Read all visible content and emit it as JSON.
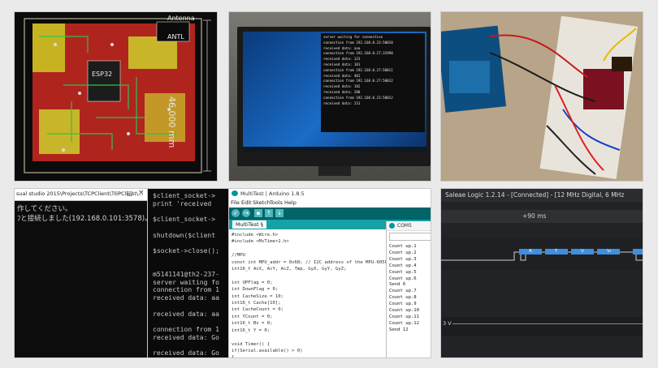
{
  "pcb": {
    "antenna": "Antenna",
    "antl": "ANTL",
    "dimension": "46.000 mm",
    "label_mid": "ESP32"
  },
  "monitor": {
    "terminal_lines": [
      "server waiting for connection",
      "connection from 192.168.0.23:50010",
      "received data: aaa",
      "connection from 192.168.0.27:31990",
      "received data: 123",
      "received data: 101",
      "connection from 192.168.0.27:50011",
      "received data: 401",
      "connection from 192.168.0.27:50012",
      "received data: 102",
      "received data: 200",
      "connection from 192.168.0.23:50012",
      "received data: 231"
    ]
  },
  "console_win": {
    "path": "sual studio 2015\\Projects\\TCPClient\\TCPClient\\...",
    "line1": "作してください。",
    "line2": "ﾌと接続しました(192.168.0.101:3578)。"
  },
  "console_php": {
    "lines": [
      "$client_socket->",
      "print 'received",
      "",
      "$client_socket->",
      "",
      "shutdown($client",
      "",
      "$socket->close();",
      "",
      "",
      "m5141141@th2-237-",
      "server waiting fo",
      "connection from 1",
      "received data: aa",
      "",
      "received data: aa",
      "",
      "connection from 1",
      "received data: Go",
      "",
      "received data: Go"
    ]
  },
  "arduino": {
    "title": "MultiTest | Arduino 1.8.5",
    "menus": [
      "File",
      "Edit",
      "Sketch",
      "Tools",
      "Help"
    ],
    "tab": "MultiTest §",
    "serial_title": "COM5",
    "code": [
      "#include <Wire.h>",
      "#include <MsTimer2.h>",
      "",
      "//MPU",
      "const int MPU_addr = 0x68; // I2C address of the MPU-6050",
      "int16_t AcX, AcY, AcZ, Tmp, GyX, GyY, GyZ;",
      "",
      "int UPFlag = 0;",
      "int DownFlag = 0;",
      "int CacheSize = 10;",
      "int16_t  Cache[10];",
      "int CacheCount = 0;",
      "int YCount = 0;",
      "int16_t Bv = 0;",
      "int16_t Y = 0;",
      "",
      "void Timer() {",
      "  if(Serial.available() > 0)",
      "  {"
    ],
    "serial_lines": [
      "Count up.1",
      "Count up.2",
      "Count up.3",
      "Count up.4",
      "Count up.5",
      "Count up.6",
      "Send 6",
      "Count up.7",
      "Count up.8",
      "Count up.9",
      "Count up.10",
      "Count up.11",
      "Count up.12",
      "Send 12"
    ]
  },
  "saleae": {
    "title": "Saleae Logic 1.2.14 - [Connected] - [12 MHz Digital, 6 MHz",
    "time_label": "+90 ms",
    "markers": [
      "A",
      "T",
      "\\r",
      "\\n"
    ],
    "voltage": "3 V"
  }
}
